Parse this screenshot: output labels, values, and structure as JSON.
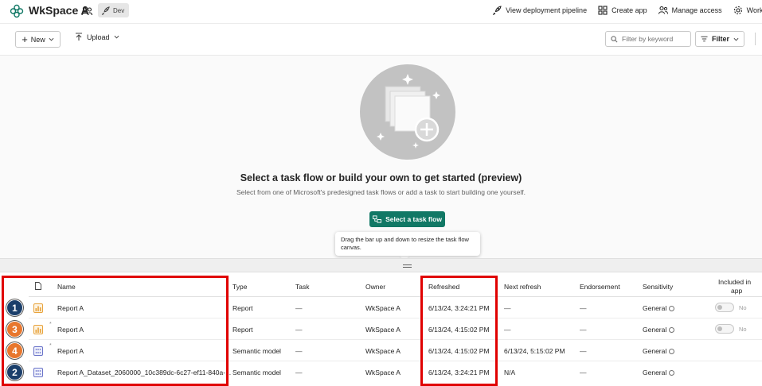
{
  "header": {
    "workspace_name": "WkSpace A",
    "badge_label": "Dev",
    "actions": [
      {
        "label": "View deployment pipeline",
        "icon": "rocket-icon"
      },
      {
        "label": "Create app",
        "icon": "app-grid-icon"
      },
      {
        "label": "Manage access",
        "icon": "people-icon"
      },
      {
        "label": "Works",
        "icon": "gear-icon"
      }
    ]
  },
  "toolbar": {
    "new_label": "New",
    "upload_label": "Upload",
    "filter_placeholder": "Filter by keyword",
    "filter_label": "Filter"
  },
  "canvas": {
    "title": "Select a task flow or build your own to get started (preview)",
    "subtitle": "Select from one of Microsoft's predesigned task flows or add a task to start building one yourself.",
    "select_button": "Select a task flow",
    "tooltip": "Drag the bar up and down to resize the task flow canvas."
  },
  "table": {
    "columns": {
      "name": "Name",
      "type": "Type",
      "task": "Task",
      "owner": "Owner",
      "refreshed": "Refreshed",
      "next_refresh": "Next refresh",
      "endorsement": "Endorsement",
      "sensitivity": "Sensitivity",
      "included_line1": "Included in",
      "included_line2": "app"
    },
    "rows": [
      {
        "badge": "1",
        "badge_color": "#1b3f6b",
        "icon": "report-icon",
        "name": "Report A",
        "type": "Report",
        "task": "—",
        "owner": "WkSpace A",
        "refreshed": "6/13/24, 3:24:21 PM",
        "next_refresh": "—",
        "endorsement": "—",
        "sensitivity": "General",
        "included": "No",
        "has_toggle": true
      },
      {
        "badge": "3",
        "badge_color": "#e8772e",
        "icon": "report-icon",
        "name": "Report A",
        "type": "Report",
        "task": "—",
        "owner": "WkSpace A",
        "refreshed": "6/13/24, 4:15:02 PM",
        "next_refresh": "—",
        "endorsement": "—",
        "sensitivity": "General",
        "included": "No",
        "has_toggle": true
      },
      {
        "badge": "4",
        "badge_color": "#e8772e",
        "icon": "semantic-model-icon",
        "name": "Report A",
        "type": "Semantic model",
        "task": "—",
        "owner": "WkSpace A",
        "refreshed": "6/13/24, 4:15:02 PM",
        "next_refresh": "6/13/24, 5:15:02 PM",
        "endorsement": "—",
        "sensitivity": "General",
        "included": "",
        "has_toggle": false
      },
      {
        "badge": "2",
        "badge_color": "#1b3f6b",
        "icon": "semantic-model-icon",
        "name": "Report A_Dataset_2060000_10c389dc-6c27-ef11-840a-...",
        "type": "Semantic model",
        "task": "—",
        "owner": "WkSpace A",
        "refreshed": "6/13/24, 3:24:21 PM",
        "next_refresh": "N/A",
        "endorsement": "—",
        "sensitivity": "General",
        "included": "",
        "has_toggle": false
      }
    ]
  },
  "colors": {
    "accent_green": "#117865",
    "highlight_red": "#e00000",
    "badge_navy": "#1b3f6b",
    "badge_orange": "#e8772e"
  }
}
